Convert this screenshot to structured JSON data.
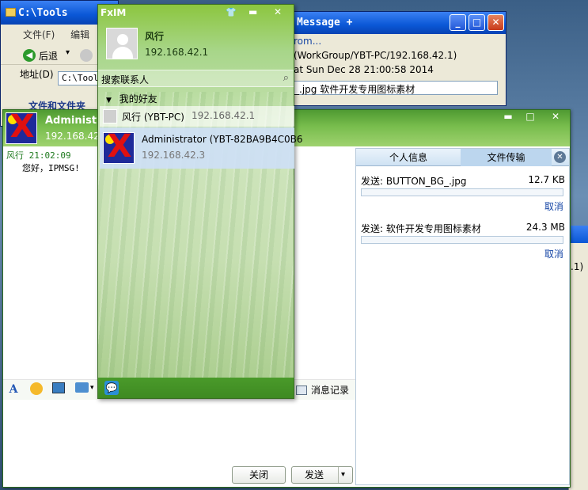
{
  "explorer": {
    "title": "C:\\Tools",
    "menu": [
      "文件(F)",
      "编辑"
    ],
    "back_label": "后退",
    "address_label": "地址(D)",
    "address_value": "C:\\Tools",
    "tasks_label": "文件和文件夹"
  },
  "message_window": {
    "title": "Message +",
    "from_line": "rom...",
    "host_line": "(WorkGroup/YBT-PC/192.168.42.1)",
    "date_line": "at Sun Dec 28 21:00:58 2014",
    "file_line": "_.jpg 软件开发专用图标素材"
  },
  "fxim": {
    "app_title": "FxIM",
    "user_name": "风行",
    "user_ip": "192.168.42.1",
    "search_placeholder": "搜索联系人",
    "group_label": "我的好友",
    "contacts": [
      {
        "name": "风行 (YBT-PC)",
        "ip": "192.168.42.1"
      },
      {
        "name": "Administrator (YBT-82BA9B4C0B6",
        "ip": "192.168.42.3"
      }
    ]
  },
  "chat": {
    "contact_name": "Administ",
    "contact_ip": "192.168.42.",
    "messages": [
      {
        "sender": "风行 21:02:09",
        "text": "您好，IPMSG!"
      }
    ],
    "history_button": "消息记录",
    "close_button": "关闭",
    "send_button": "发送"
  },
  "transfer_panel": {
    "tabs": [
      "个人信息",
      "文件传输"
    ],
    "active_tab": 1,
    "items": [
      {
        "label": "发送: BUTTON_BG_.jpg",
        "size": "12.7 KB",
        "progress": 0.0,
        "cancel": "取消"
      },
      {
        "label": "发送: 软件开发专用图标素材",
        "size": "24.3 MB",
        "progress": 0.0,
        "cancel": "取消"
      }
    ]
  },
  "right_window": {
    "fragment": ".1)"
  }
}
